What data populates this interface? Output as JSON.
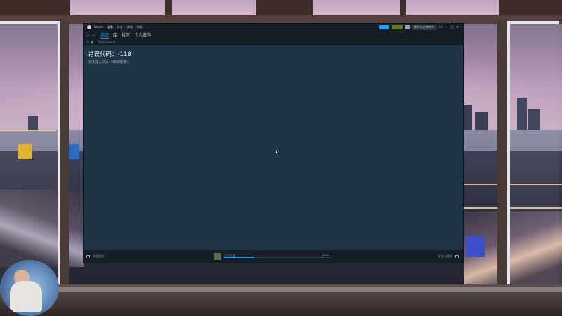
{
  "steam": {
    "title_menu": [
      "Steam",
      "查看",
      "好友",
      "游戏",
      "帮助"
    ],
    "announce_label": "",
    "store_label": "",
    "account_name": "用户名名称的个",
    "window_controls": [
      "minimize-icon",
      "maximize-icon",
      "close-icon"
    ],
    "nav": {
      "links": [
        "商店",
        "库",
        "社区",
        "个人资料"
      ],
      "active_index": 0
    },
    "url": "https://store...",
    "error": {
      "title": "错误代码：-118",
      "description": "无法载入网页（未知错误）。"
    },
    "footer": {
      "left_label": "添加游戏",
      "download_label": "正在下载",
      "download_percent": "28%",
      "download_progress": 0.28,
      "right_label": "好友与聊天"
    }
  },
  "colors": {
    "accent": "#1a9fff",
    "content_bg": "#1d3547",
    "chrome_bg": "#171d25"
  }
}
